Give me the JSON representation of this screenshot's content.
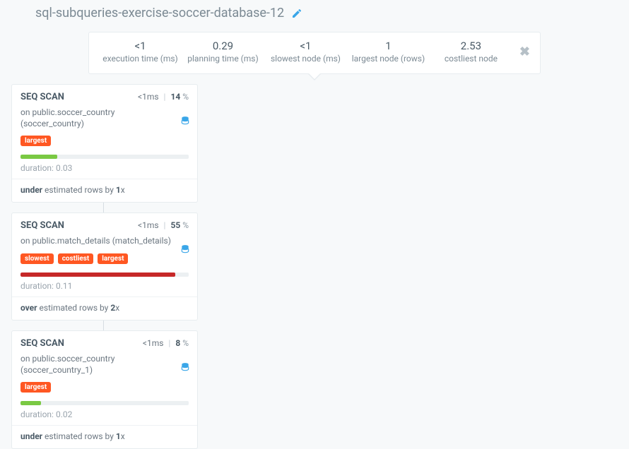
{
  "header": {
    "title": "sql-subqueries-exercise-soccer-database-12"
  },
  "stats": [
    {
      "value": "<1",
      "label": "execution time (ms)"
    },
    {
      "value": "0.29",
      "label": "planning time (ms)"
    },
    {
      "value": "<1",
      "label": "slowest node (ms)"
    },
    {
      "value": "1",
      "label": "largest node (rows)"
    },
    {
      "value": "2.53",
      "label": "costliest node"
    }
  ],
  "nodes": [
    {
      "type": "SEQ SCAN",
      "time": "<1ms",
      "pct": "14",
      "on_prefix": "on ",
      "relation": "public.soccer_country (soccer_country)",
      "tags": [
        "largest"
      ],
      "bar_width": "22%",
      "bar_color": "#7ac943",
      "duration_label": "duration: ",
      "duration": "0.03",
      "est_bold": "under",
      "est_mid": " estimated rows by ",
      "est_factor": "1",
      "est_suffix": "x"
    },
    {
      "type": "SEQ SCAN",
      "time": "<1ms",
      "pct": "55",
      "on_prefix": "on ",
      "relation": "public.match_details (match_details)",
      "tags": [
        "slowest",
        "costliest",
        "largest"
      ],
      "bar_width": "92%",
      "bar_color": "#c62828",
      "duration_label": "duration: ",
      "duration": "0.11",
      "est_bold": "over",
      "est_mid": " estimated rows by ",
      "est_factor": "2",
      "est_suffix": "x"
    },
    {
      "type": "SEQ SCAN",
      "time": "<1ms",
      "pct": "8",
      "on_prefix": "on ",
      "relation": "public.soccer_country (soccer_country_1)",
      "tags": [
        "largest"
      ],
      "bar_width": "12%",
      "bar_color": "#7ac943",
      "duration_label": "duration: ",
      "duration": "0.02",
      "est_bold": "under",
      "est_mid": " estimated rows by ",
      "est_factor": "1",
      "est_suffix": "x"
    }
  ]
}
